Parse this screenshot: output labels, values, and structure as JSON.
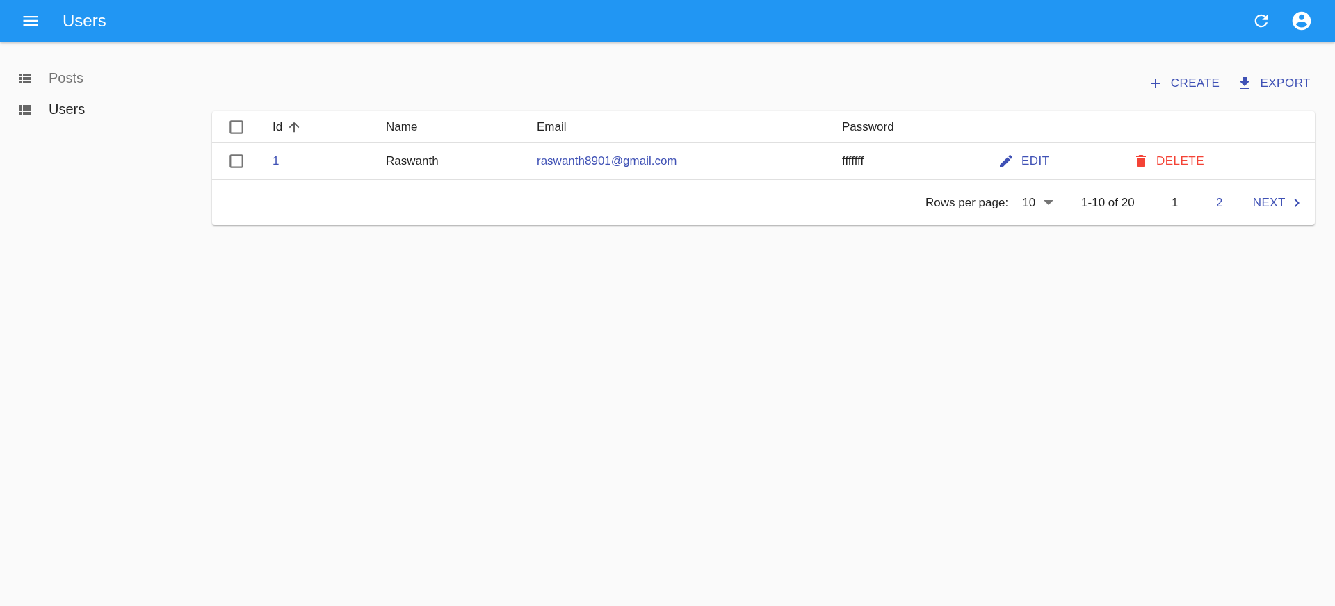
{
  "app_bar": {
    "title": "Users"
  },
  "sidebar": {
    "items": [
      {
        "label": "Posts",
        "selected": false
      },
      {
        "label": "Users",
        "selected": true
      }
    ]
  },
  "actions": [
    {
      "kind": "create",
      "label": "CREATE"
    },
    {
      "kind": "export",
      "label": "EXPORT"
    }
  ],
  "table": {
    "columns": [
      {
        "label": "Id",
        "sorted": true
      },
      {
        "label": "Name",
        "sorted": false
      },
      {
        "label": "Email",
        "sorted": false
      },
      {
        "label": "Password",
        "sorted": false
      }
    ],
    "rows": [
      {
        "checked": false,
        "id": "1",
        "name": "Raswanth",
        "email": "raswanth8901@gmail.com",
        "password": "fffffff",
        "edit": "EDIT",
        "delete": "DELETE"
      }
    ],
    "select_all": {
      "checked": false
    }
  },
  "pagination": {
    "rows_per_page_label": "Rows per page:",
    "rows_per_page": "10",
    "range": "1-10 of 20",
    "pages": [
      {
        "label": "1",
        "selected": true
      },
      {
        "label": "2",
        "selected": false
      }
    ],
    "next": "NEXT"
  }
}
